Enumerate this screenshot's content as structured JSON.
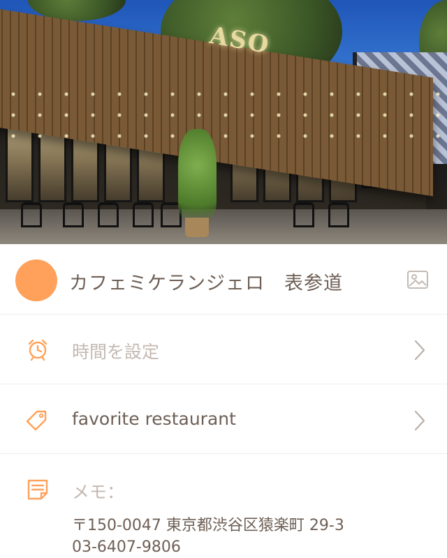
{
  "hero": {
    "sign_text": "ASO"
  },
  "place": {
    "title": "カフェミケランジェロ　表参道",
    "avatar_color": "#ffa15a",
    "image_icon": "image-icon"
  },
  "rows": {
    "time": {
      "icon": "alarm-clock-icon",
      "label": "時間を設定"
    },
    "tag": {
      "icon": "tag-icon",
      "label": "favorite restaurant"
    },
    "memo": {
      "icon": "memo-icon",
      "label": "メモ：",
      "lines": [
        "〒150-0047 東京都渋谷区猿楽町 29-3",
        "03-6407-9806"
      ]
    }
  },
  "colors": {
    "accent": "#ffa15a",
    "label_muted": "#c4b9b2",
    "text": "#6e5f55",
    "chevron": "#b8b0aa",
    "divider": "#eeeeee"
  }
}
